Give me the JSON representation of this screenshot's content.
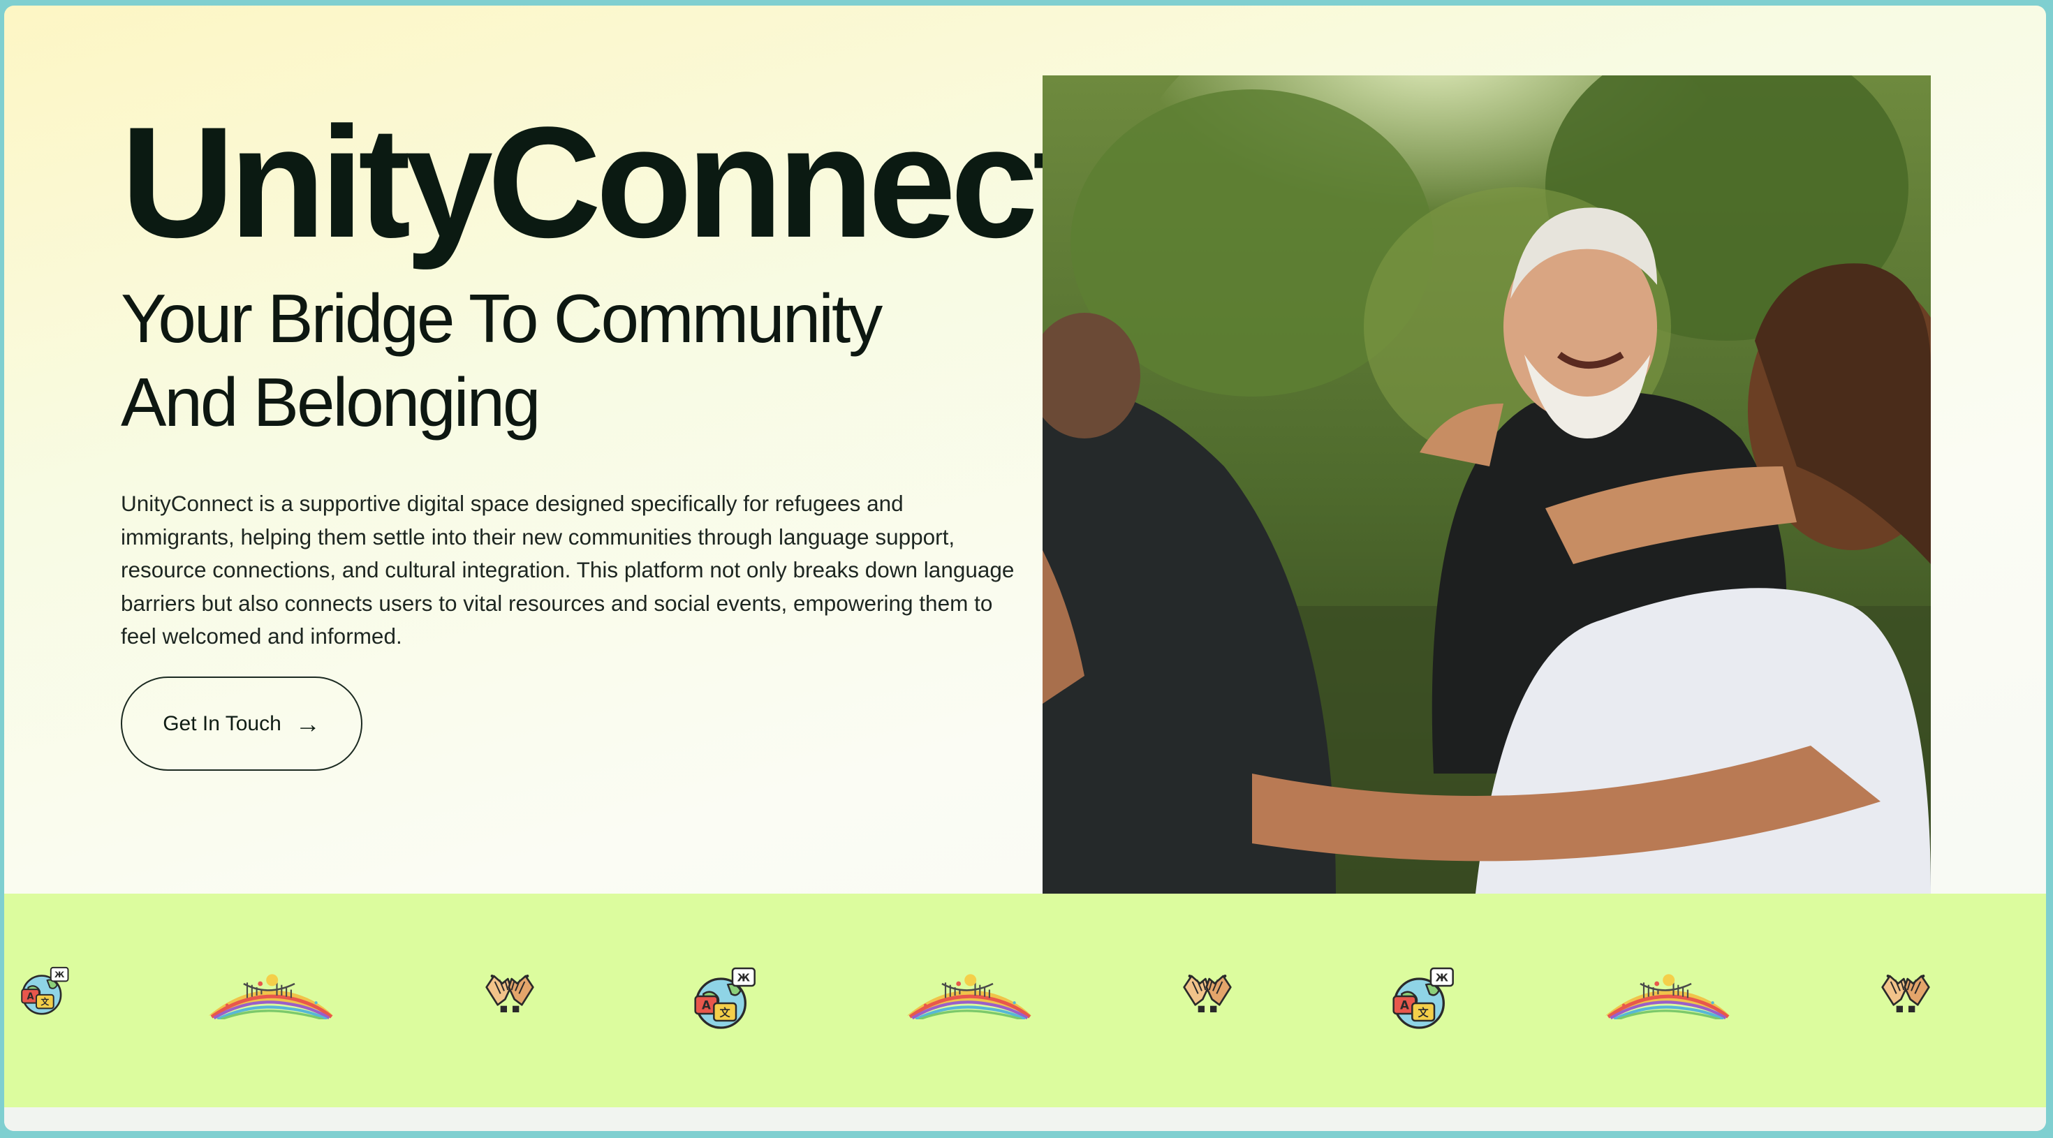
{
  "hero": {
    "brand": "UnityConnect",
    "tagline_line1": "Your Bridge To Community",
    "tagline_line2": "And Belonging",
    "description": "UnityConnect is a supportive digital space designed specifically for refugees and immigrants, helping them settle into their new communities through language support, resource connections, and cultural integration. This platform not only breaks down language barriers but also connects users to vital resources and social events, empowering them to feel welcomed and informed.",
    "cta_label": "Get In Touch",
    "cta_icon": "arrow-right-icon",
    "photo_subject": "community-group-hug-photo"
  },
  "icon_band": {
    "background": "#dcfc9e",
    "icons": [
      "globe-translate-icon",
      "rainbow-bridge-icon",
      "handshake-icon",
      "globe-translate-icon",
      "rainbow-bridge-icon",
      "handshake-icon",
      "globe-translate-icon",
      "rainbow-bridge-icon",
      "handshake-icon"
    ]
  },
  "colors": {
    "text_dark": "#0b1a12",
    "band_green": "#dcfc9e",
    "outer_frame": "#7fcfd0"
  }
}
